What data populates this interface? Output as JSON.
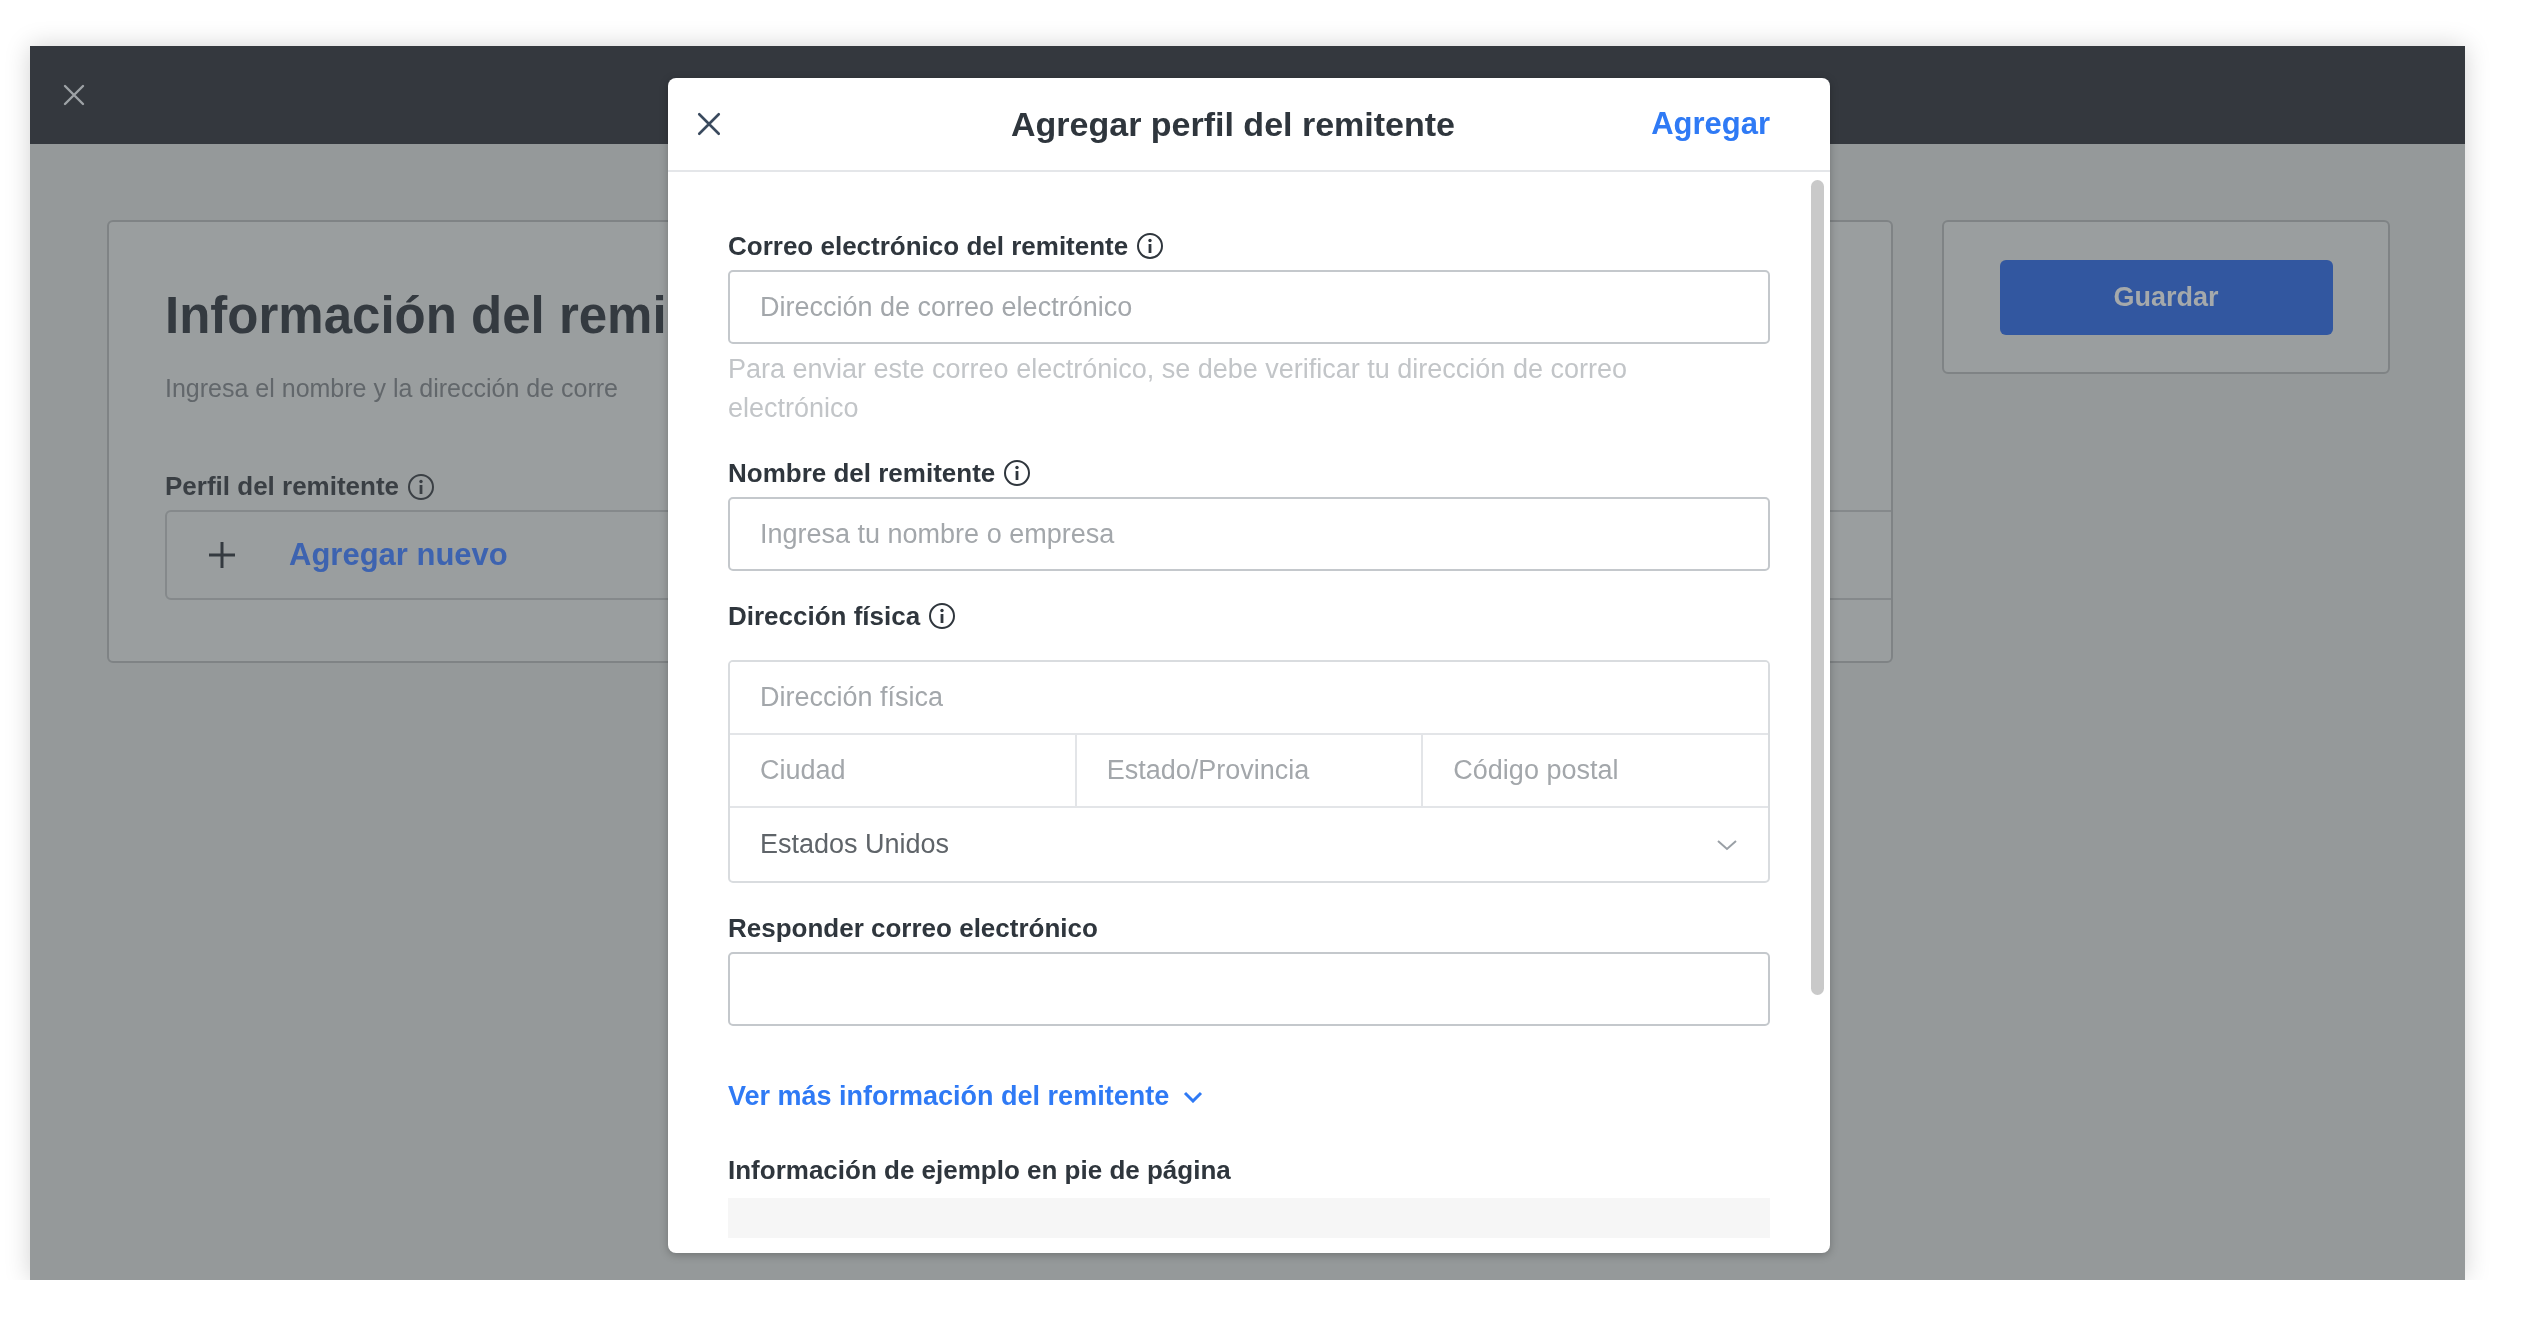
{
  "page": {
    "title": "Información del remi",
    "subtitle": "Ingresa el nombre y la dirección de corre",
    "profile_label": "Perfil del remitente",
    "add_new": "Agregar nuevo",
    "save_button": "Guardar"
  },
  "modal": {
    "title": "Agregar perfil del remitente",
    "action": "Agregar",
    "fields": [
      {
        "kind": "input",
        "label": "Correo electrónico del remitente",
        "info": true,
        "placeholder": "Dirección de correo electrónico",
        "help": "Para enviar este correo electrónico, se debe verificar tu dirección de correo electrónico"
      },
      {
        "kind": "input",
        "label": "Nombre del remitente",
        "info": true,
        "placeholder": "Ingresa tu nombre o empresa"
      },
      {
        "kind": "address",
        "label": "Dirección física",
        "info": true,
        "street_placeholder": "Dirección física",
        "city_placeholder": "Ciudad",
        "state_placeholder": "Estado/Provincia",
        "zip_placeholder": "Código postal",
        "country": "Estados Unidos"
      },
      {
        "kind": "input",
        "label": "Responder correo electrónico",
        "info": false
      }
    ],
    "more_link": "Ver más información del remitente",
    "footer_label": "Información de ejemplo en pie de página"
  }
}
